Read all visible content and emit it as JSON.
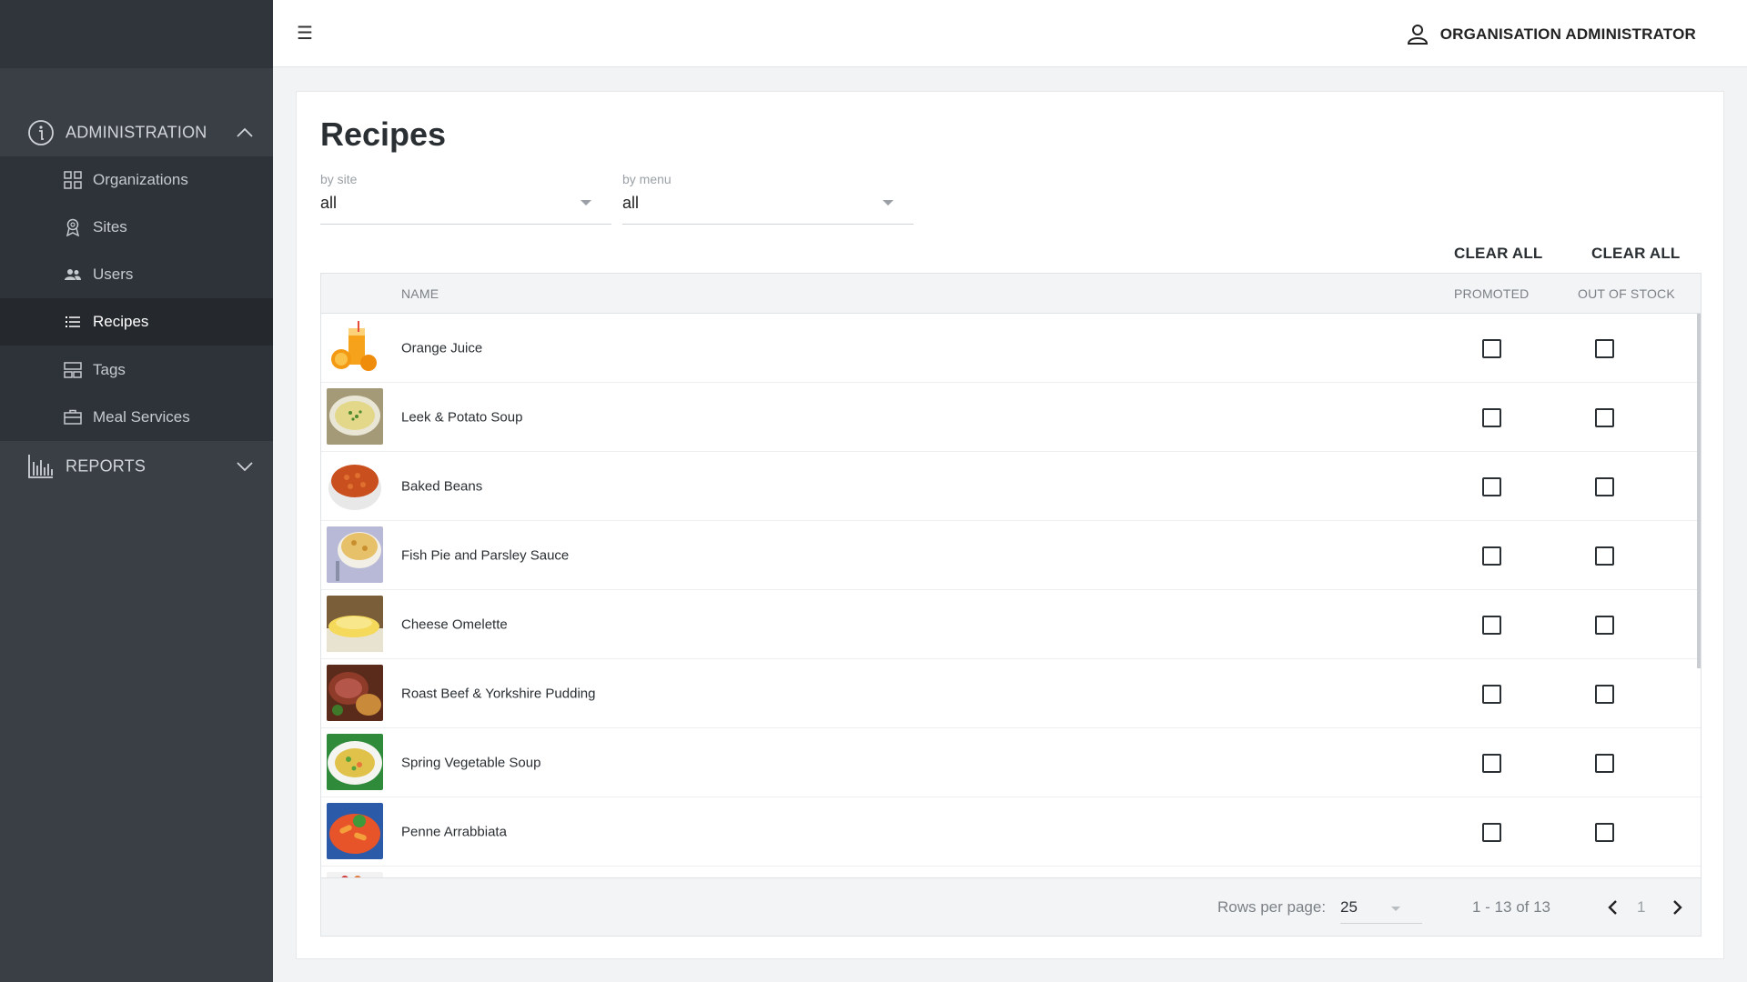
{
  "sidebar": {
    "groups": [
      {
        "label": "ADMINISTRATION",
        "icon": "info-icon",
        "expanded": true
      },
      {
        "label": "REPORTS",
        "icon": "bar-chart-icon",
        "expanded": false
      }
    ],
    "items": [
      {
        "label": "Organizations",
        "icon": "grid-icon",
        "active": false
      },
      {
        "label": "Sites",
        "icon": "location-badge-icon",
        "active": false
      },
      {
        "label": "Users",
        "icon": "users-icon",
        "active": false
      },
      {
        "label": "Recipes",
        "icon": "list-icon",
        "active": true
      },
      {
        "label": "Tags",
        "icon": "tags-icon",
        "active": false
      },
      {
        "label": "Meal Services",
        "icon": "briefcase-icon",
        "active": false
      }
    ]
  },
  "header": {
    "menu_icon": "hamburger-icon",
    "user_icon": "person-icon",
    "user_label": "ORGANISATION ADMINISTRATOR"
  },
  "page": {
    "title": "Recipes",
    "filters": [
      {
        "label": "by site",
        "value": "all"
      },
      {
        "label": "by menu",
        "value": "all"
      }
    ],
    "clear_all_promoted": "CLEAR ALL",
    "clear_all_out_of_stock": "CLEAR ALL"
  },
  "table": {
    "columns": {
      "name": "NAME",
      "promoted": "PROMOTED",
      "out_of_stock": "OUT OF STOCK"
    },
    "rows": [
      {
        "name": "Orange Juice",
        "promoted": false,
        "out_of_stock": false
      },
      {
        "name": "Leek & Potato Soup",
        "promoted": false,
        "out_of_stock": false
      },
      {
        "name": "Baked Beans",
        "promoted": false,
        "out_of_stock": false
      },
      {
        "name": "Fish Pie and Parsley Sauce",
        "promoted": false,
        "out_of_stock": false
      },
      {
        "name": "Cheese Omelette",
        "promoted": false,
        "out_of_stock": false
      },
      {
        "name": "Roast Beef & Yorkshire Pudding",
        "promoted": false,
        "out_of_stock": false
      },
      {
        "name": "Spring Vegetable Soup",
        "promoted": false,
        "out_of_stock": false
      },
      {
        "name": "Penne Arrabbiata",
        "promoted": false,
        "out_of_stock": false
      }
    ],
    "footer": {
      "rows_per_page_label": "Rows per page:",
      "rows_per_page_value": "25",
      "range": "1 - 13 of 13",
      "page": "1"
    }
  }
}
